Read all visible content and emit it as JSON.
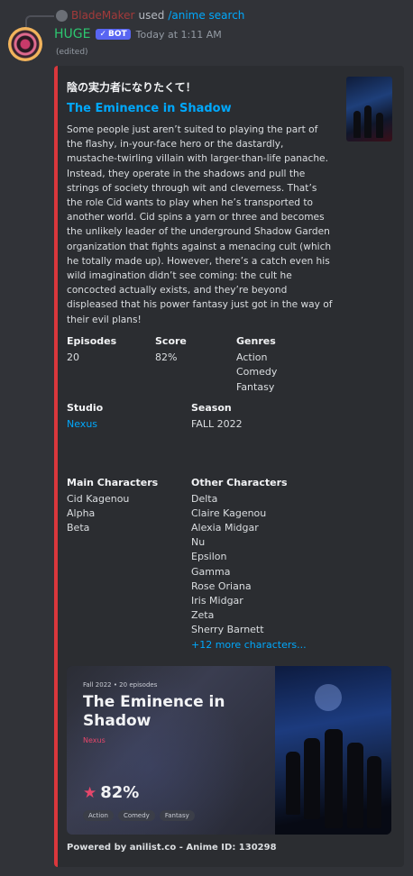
{
  "reply": {
    "username": "BladeMaker",
    "used_text": "used",
    "command": "/anime search"
  },
  "message": {
    "author": "HUGE",
    "bot_tag": "BOT",
    "timestamp": "Today at 1:11 AM",
    "edited": "(edited)"
  },
  "embed": {
    "color": "#da373c",
    "title_jp": "陰の実力者になりたくて！",
    "title_en": "The Eminence in Shadow",
    "description": "Some people just aren’t suited to playing the part of the flashy, in-your-face hero or the dastardly, mustache-twirling villain with larger-than-life panache. Instead, they operate in the shadows and pull the strings of society through wit and cleverness. That’s the role Cid wants to play when he’s transported to another world. Cid spins a yarn or three and becomes the unlikely leader of the underground Shadow Garden organization that fights against a menacing cult (which he totally made up). However, there’s a catch even his wild imagination didn’t see coming: the cult he concocted actually exists, and they’re beyond displeased that his power fantasy just got in the way of their evil plans!",
    "fields": {
      "episodes": {
        "name": "Episodes",
        "value": "20"
      },
      "score": {
        "name": "Score",
        "value": "82%"
      },
      "genres": {
        "name": "Genres",
        "values": [
          "Action",
          "Comedy",
          "Fantasy"
        ]
      },
      "studio": {
        "name": "Studio",
        "value": "Nexus"
      },
      "season": {
        "name": "Season",
        "value": "FALL 2022"
      },
      "main_characters": {
        "name": "Main Characters",
        "values": [
          "Cid Kagenou",
          "Alpha",
          "Beta"
        ]
      },
      "other_characters": {
        "name": "Other Characters",
        "values": [
          "Delta",
          "Claire Kagenou",
          "Alexia Midgar",
          "Nu",
          "Epsilon",
          "Gamma",
          "Rose Oriana",
          "Iris Midgar",
          "Zeta",
          "Sherry Barnett"
        ],
        "more": "+12 more characters..."
      }
    },
    "banner": {
      "meta": "Fall 2022 • 20 episodes",
      "title": "The Eminence in Shadow",
      "studio": "Nexus",
      "score": "82%",
      "tags": [
        "Action",
        "Comedy",
        "Fantasy"
      ]
    },
    "footer": "Powered by anilist.co - Anime ID: 130298"
  }
}
